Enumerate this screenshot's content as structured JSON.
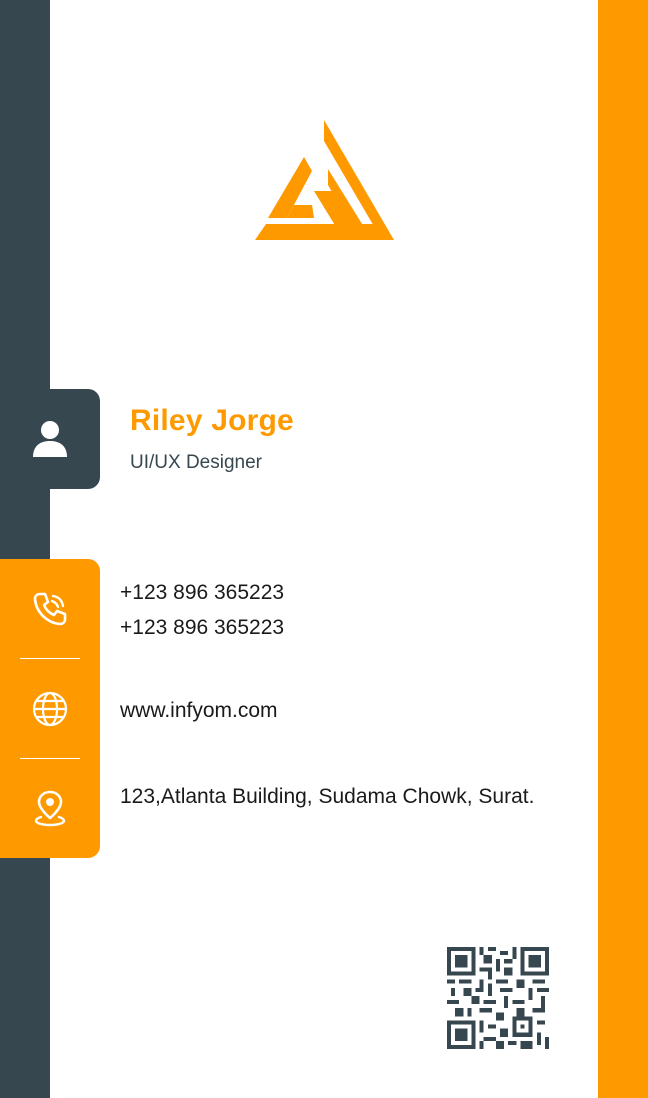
{
  "card": {
    "name": "Riley Jorge",
    "role": "UI/UX Designer",
    "phones": [
      "+123 896 365223",
      "+123 896 365223"
    ],
    "website": "www.infyom.com",
    "address": "123,Atlanta Building, Sudama Chowk, Surat."
  },
  "colors": {
    "accent": "#fe9a00",
    "dark": "#37474f",
    "background": "#ffffff"
  },
  "icons": {
    "logo": "triangle-logo",
    "avatar": "user-icon",
    "phone": "phone-icon",
    "website": "globe-icon",
    "address": "location-pin-icon",
    "qr": "qr-code"
  }
}
